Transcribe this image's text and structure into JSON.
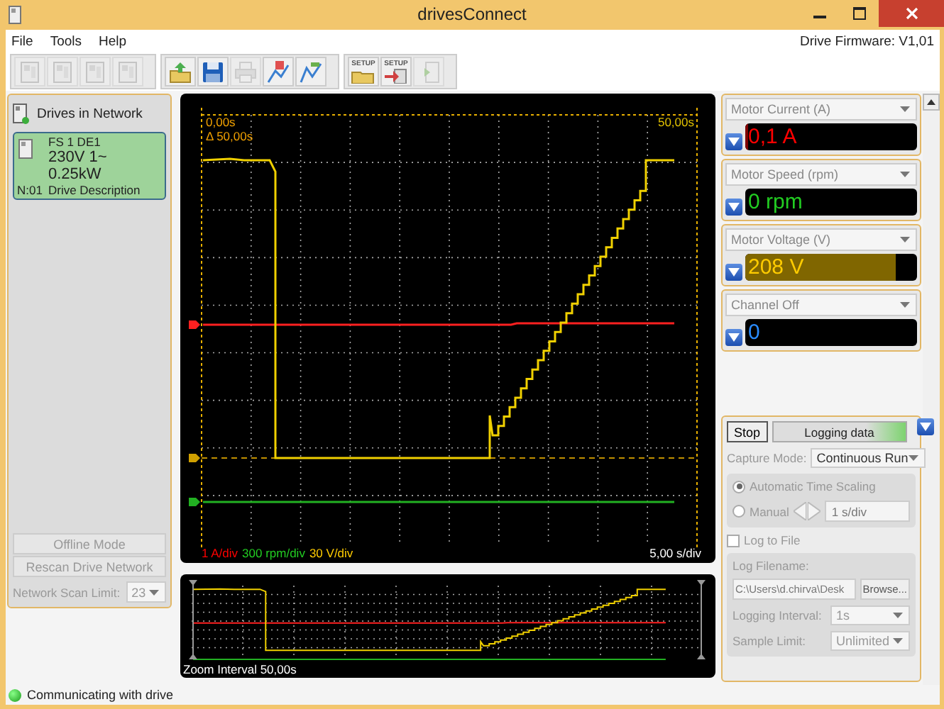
{
  "window": {
    "title": "drivesConnect"
  },
  "menu": [
    "File",
    "Tools",
    "Help"
  ],
  "firmware": "Drive Firmware: V1,01",
  "toolbar": [
    [
      {
        "kind": "drive",
        "disabled": true
      },
      {
        "kind": "drive",
        "disabled": true
      },
      {
        "kind": "drive",
        "disabled": true
      },
      {
        "kind": "drive",
        "disabled": true
      }
    ],
    [
      {
        "kind": "upload",
        "disabled": false
      },
      {
        "kind": "save",
        "disabled": false
      },
      {
        "kind": "print",
        "disabled": true
      },
      {
        "kind": "chart-add",
        "disabled": false
      },
      {
        "kind": "chart",
        "disabled": false
      }
    ],
    [
      {
        "kind": "setup-open",
        "disabled": false,
        "label": "SETUP"
      },
      {
        "kind": "setup-save",
        "disabled": false,
        "label": "SETUP"
      },
      {
        "kind": "import",
        "disabled": true
      }
    ]
  ],
  "drives_panel": {
    "title": "Drives in Network",
    "drives": [
      {
        "name": "FS 1  DE1",
        "rating": "230V 1~  0.25kW",
        "node": "N:01",
        "description": "Drive Description",
        "selected": true
      }
    ],
    "offline_button": "Offline Mode",
    "rescan_button": "Rescan Drive Network",
    "scan_limit_label": "Network Scan Limit:",
    "scan_limit": "23",
    "disabled": true
  },
  "scope": {
    "cursor_start": "0,00s",
    "cursor_delta": "Δ 50,00s",
    "cursor_end": "50,00s",
    "scales": [
      {
        "text": "1 A/div",
        "color": "#ff0000"
      },
      {
        "text": "300 rpm/div",
        "color": "#22cc22"
      },
      {
        "text": "30 V/div",
        "color": "#ffcc00"
      }
    ],
    "time_scale": "5,00 s/div",
    "zoom_interval": "Zoom Interval 50,00s"
  },
  "channels": [
    {
      "signal": "Motor Current (A)",
      "reading": "0,1 A",
      "color": "#ff0000",
      "level": 0.02
    },
    {
      "signal": "Motor Speed (rpm)",
      "reading": "0 rpm",
      "color": "#22cc22",
      "level": 0
    },
    {
      "signal": "Motor Voltage (V)",
      "reading": "208 V",
      "color": "#ffcc00",
      "level": 0.88
    },
    {
      "signal": "Channel Off",
      "reading": "0",
      "color": "#2a8cff",
      "level": 0
    }
  ],
  "logging": {
    "stop_button": "Stop",
    "progress_label": "Logging data",
    "active": true,
    "options_disabled": true,
    "capture_mode_label": "Capture Mode:",
    "capture_mode": "Continuous Run",
    "scaling": [
      {
        "label": "Automatic Time Scaling",
        "selected": true
      },
      {
        "label": "Manual",
        "selected": false
      }
    ],
    "manual_value": "1  s/div",
    "log_to_file": {
      "label": "Log to File",
      "checked": false
    },
    "filename_label": "Log Filename:",
    "filename": "C:\\Users\\d.chirva\\Desk",
    "browse_button": "Browse...",
    "interval_label": "Logging Interval:",
    "interval": "1s",
    "sample_limit_label": "Sample Limit:",
    "sample_limit": "Unlimited"
  },
  "status_bar": {
    "text": "Communicating with drive",
    "connected": true
  }
}
